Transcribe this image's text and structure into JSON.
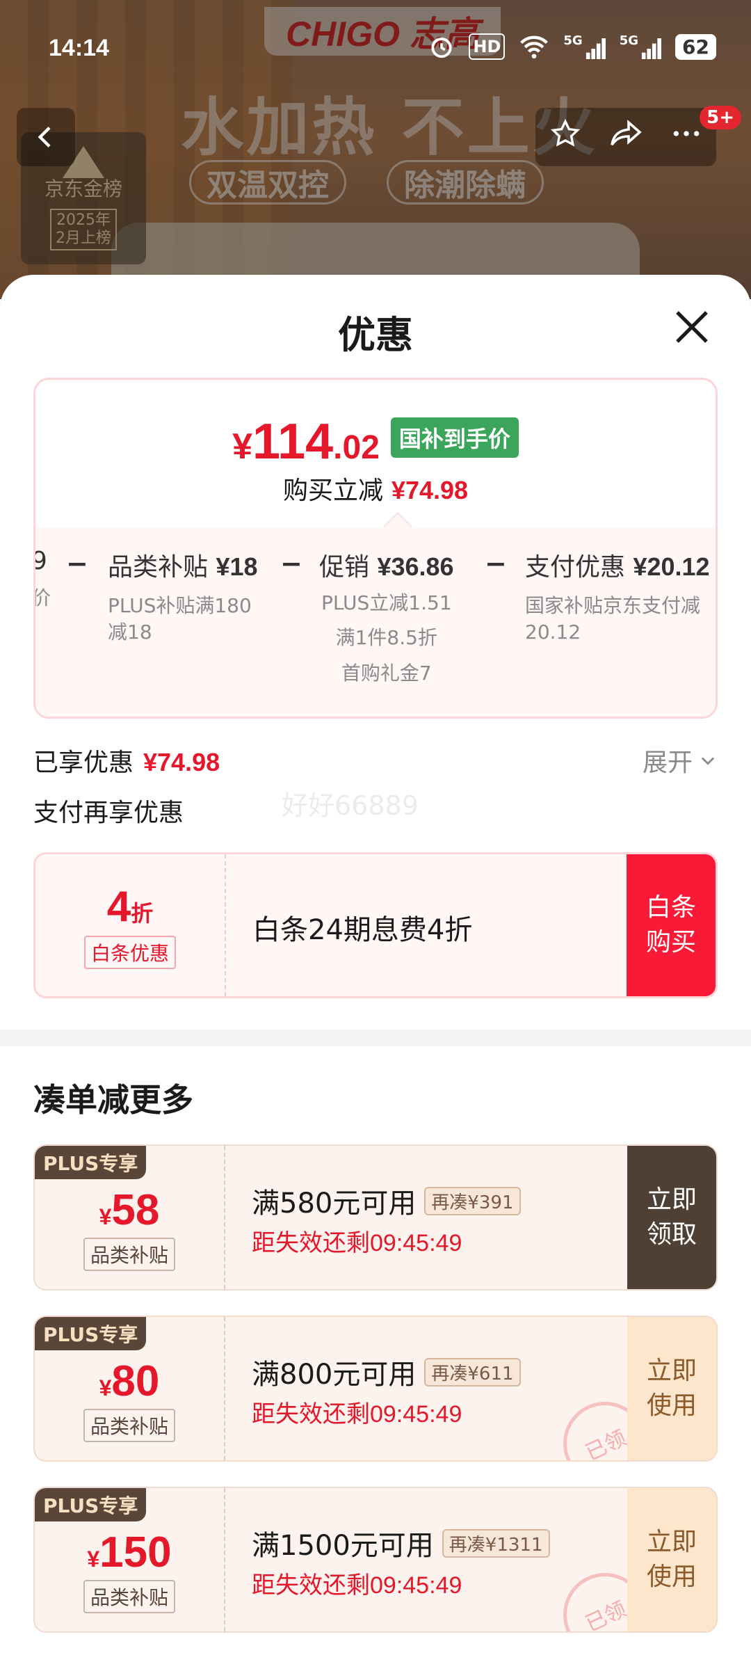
{
  "status_bar": {
    "time": "14:14",
    "battery": "62",
    "icons": [
      "alarm-icon",
      "hd-icon",
      "wifi-icon",
      "5g-signal-icon",
      "5g-signal-icon"
    ],
    "network_labels": [
      "HD",
      "5G",
      "5G"
    ]
  },
  "banner": {
    "brand": "CHIGO 志高",
    "headline": "水加热 不上火",
    "taglines": [
      "双温双控",
      "除潮除螨"
    ],
    "rank_title": "京东金榜",
    "rank_sub": "2025年\n2月上榜",
    "message_badge": "5+"
  },
  "sheet": {
    "title": "优惠",
    "price": {
      "yen": "¥",
      "int": "114",
      "dec": ".02",
      "tag": "国补到手价",
      "reduce_label": "购买立减",
      "reduce_amount": "¥74.98"
    },
    "breakdown": [
      {
        "title": "9",
        "amount": "",
        "sub": "价"
      },
      {
        "title": "品类补贴",
        "amount": "¥18",
        "sub": "PLUS补贴满180\n减18"
      },
      {
        "title": "促销",
        "amount": "¥36.86",
        "sub": "PLUS立减1.51\n满1件8.5折\n首购礼金7"
      },
      {
        "title": "支付优惠",
        "amount": "¥20.12",
        "sub": "国家补贴京东支付减\n20.12"
      }
    ],
    "enjoyed_label": "已享优惠",
    "enjoyed_amount": "¥74.98",
    "expand_label": "展开",
    "pay_more_label": "支付再享优惠",
    "watermark": "好好66889",
    "baitiao": {
      "discount_num": "4",
      "discount_unit": "折",
      "tag": "白条优惠",
      "text": "白条24期息费4折",
      "button": "白条\n购买"
    },
    "section_title": "凑单减更多",
    "coupons": [
      {
        "plus_label": "PLUS专享",
        "yen": "¥",
        "amount": "58",
        "tag": "品类补贴",
        "condition": "满580元可用",
        "more": "再凑¥391",
        "expire": "距失效还剩09:45:49",
        "button": "立即\n领取",
        "claimed": false
      },
      {
        "plus_label": "PLUS专享",
        "yen": "¥",
        "amount": "80",
        "tag": "品类补贴",
        "condition": "满800元可用",
        "more": "再凑¥611",
        "expire": "距失效还剩09:45:49",
        "button": "立即\n使用",
        "claimed": true,
        "stamp": "已领"
      },
      {
        "plus_label": "PLUS专享",
        "yen": "¥",
        "amount": "150",
        "tag": "品类补贴",
        "condition": "满1500元可用",
        "more": "再凑¥1311",
        "expire": "距失效还剩09:45:49",
        "button": "立即\n使用",
        "claimed": true,
        "stamp": "已领"
      }
    ]
  },
  "colors": {
    "accent_red": "#e4172b",
    "green_tag": "#3ba55c",
    "baitiao_button": "#fa1936",
    "plus_dark": "#4f4035",
    "use_button_bg": "#fde6cc"
  }
}
